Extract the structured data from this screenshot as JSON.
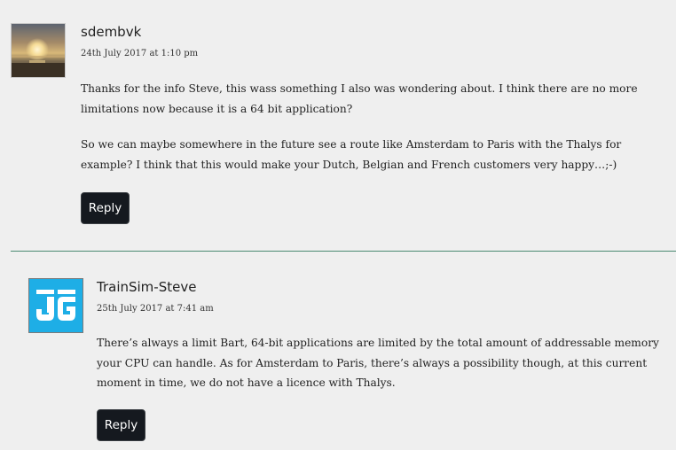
{
  "comments": [
    {
      "author": "sdembvk",
      "date": "24th July 2017 at 1:10 pm",
      "paragraphs": [
        "Thanks for the info Steve, this wass something I also was wondering about. I think there are no more limitations now because it is a 64 bit application?",
        "So we can maybe somewhere in the future see a route like Amsterdam to Paris with the Thalys for example? I think that this would make your Dutch, Belgian and French customers very happy…;-)"
      ],
      "reply_label": "Reply",
      "avatar": "sunset-photo"
    },
    {
      "author": "TrainSim-Steve",
      "date": "25th July 2017 at 7:41 am",
      "paragraphs": [
        "There’s always a limit Bart, 64-bit applications are limited by the total amount of addressable memory your CPU can handle. As for Amsterdam to Paris, there’s always a possibility though, at this current moment in time, we do not have a licence with Thalys."
      ],
      "reply_label": "Reply",
      "avatar": "jg-logo"
    }
  ],
  "colors": {
    "background": "#efefef",
    "divider": "#4a8a72",
    "reply_button": "#15191f",
    "logo_blue": "#1eaee6"
  }
}
